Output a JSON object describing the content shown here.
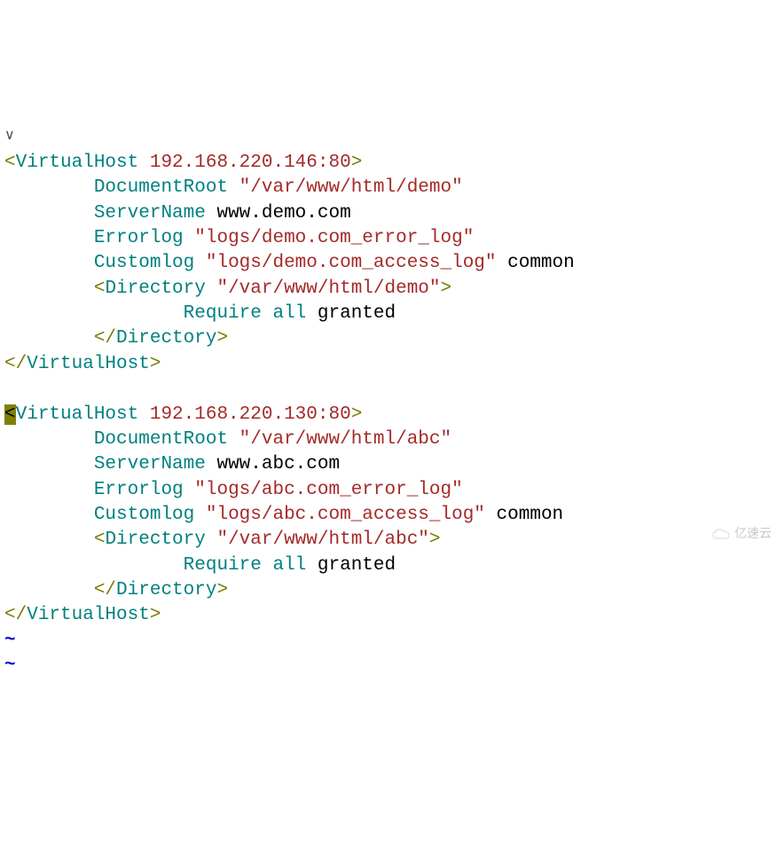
{
  "fold_marker": "∨",
  "vhosts": [
    {
      "open_tag": "VirtualHost",
      "address": "192.168.220.146:80",
      "doc_root_key": "DocumentRoot",
      "doc_root_val": "\"/var/www/html/demo\"",
      "server_name_key": "ServerName",
      "server_name_val": "www.demo.com",
      "errorlog_key": "Errorlog",
      "errorlog_val": "\"logs/demo.com_error_log\"",
      "customlog_key": "Customlog",
      "customlog_val": "\"logs/demo.com_access_log\"",
      "customlog_fmt": "common",
      "dir_key": "Directory",
      "dir_path": "\"/var/www/html/demo\"",
      "require_key": "Require",
      "require_arg1": "all",
      "require_arg2": "granted",
      "dir_close": "Directory",
      "close_tag": "VirtualHost",
      "cursor_on_open": false
    },
    {
      "open_tag": "VirtualHost",
      "address": "192.168.220.130:80",
      "doc_root_key": "DocumentRoot",
      "doc_root_val": "\"/var/www/html/abc\"",
      "server_name_key": "ServerName",
      "server_name_val": "www.abc.com",
      "errorlog_key": "Errorlog",
      "errorlog_val": "\"logs/abc.com_error_log\"",
      "customlog_key": "Customlog",
      "customlog_val": "\"logs/abc.com_access_log\"",
      "customlog_fmt": "common",
      "dir_key": "Directory",
      "dir_path": "\"/var/www/html/abc\"",
      "require_key": "Require",
      "require_arg1": "all",
      "require_arg2": "granted",
      "dir_close": "Directory",
      "close_tag": "VirtualHost",
      "cursor_on_open": true
    }
  ],
  "tilde_lines": [
    "~",
    "~"
  ],
  "watermark_text": "亿速云"
}
